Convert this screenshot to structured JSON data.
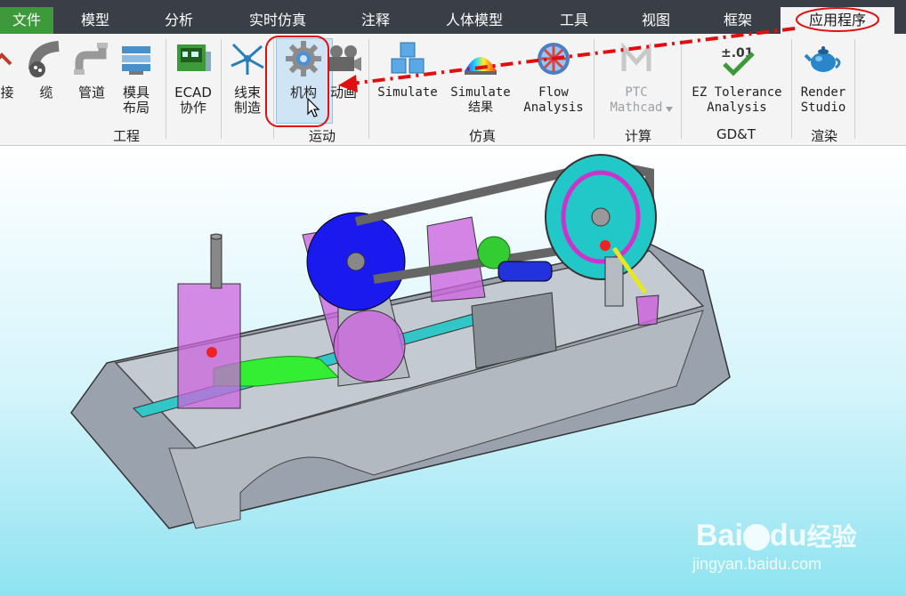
{
  "tabs": [
    {
      "label": "文件"
    },
    {
      "label": "模型"
    },
    {
      "label": "分析"
    },
    {
      "label": "实时仿真"
    },
    {
      "label": "注释"
    },
    {
      "label": "人体模型"
    },
    {
      "label": "工具"
    },
    {
      "label": "视图"
    },
    {
      "label": "框架"
    },
    {
      "label": "应用程序"
    }
  ],
  "ribbon": {
    "engineering": {
      "group_label": "工程",
      "buttons": [
        {
          "label": "接",
          "icon": "connect-icon"
        },
        {
          "label": "缆",
          "icon": "cable-icon"
        },
        {
          "label": "管道",
          "icon": "piping-icon"
        },
        {
          "label": "模具\n布局",
          "icon": "mold-layout-icon"
        },
        {
          "label": "ECAD\n协作",
          "icon": "ecad-icon"
        },
        {
          "label": "线束\n制造",
          "icon": "harness-icon"
        }
      ]
    },
    "motion": {
      "group_label": "运动",
      "buttons": [
        {
          "label": "机构",
          "icon": "gear-icon"
        },
        {
          "label": "动画",
          "icon": "camera-icon"
        }
      ]
    },
    "simulation": {
      "group_label": "仿真",
      "buttons": [
        {
          "label": "Simulate",
          "icon": "cubes-icon"
        },
        {
          "label": "Simulate\n结果",
          "icon": "rainbow-results-icon"
        },
        {
          "label": "Flow\nAnalysis",
          "icon": "flow-wheel-icon"
        }
      ]
    },
    "compute": {
      "group_label": "计算",
      "buttons": [
        {
          "label": "PTC\nMathcad",
          "icon": "mathcad-icon"
        }
      ]
    },
    "gdt": {
      "group_label": "GD&T",
      "buttons": [
        {
          "label": "EZ Tolerance\nAnalysis",
          "icon": "tolerance-icon",
          "badge": "±.01"
        }
      ]
    },
    "render": {
      "group_label": "渲染",
      "buttons": [
        {
          "label": "Render\nStudio",
          "icon": "teapot-icon"
        }
      ]
    }
  },
  "watermark": {
    "brand": "Bai",
    "brand2": "du",
    "cn": "经验",
    "url": "jingyan.baidu.com"
  },
  "colors": {
    "file_tab": "#3d9a3a",
    "annotation": "#e01010",
    "tabbar": "#3a3f47"
  }
}
